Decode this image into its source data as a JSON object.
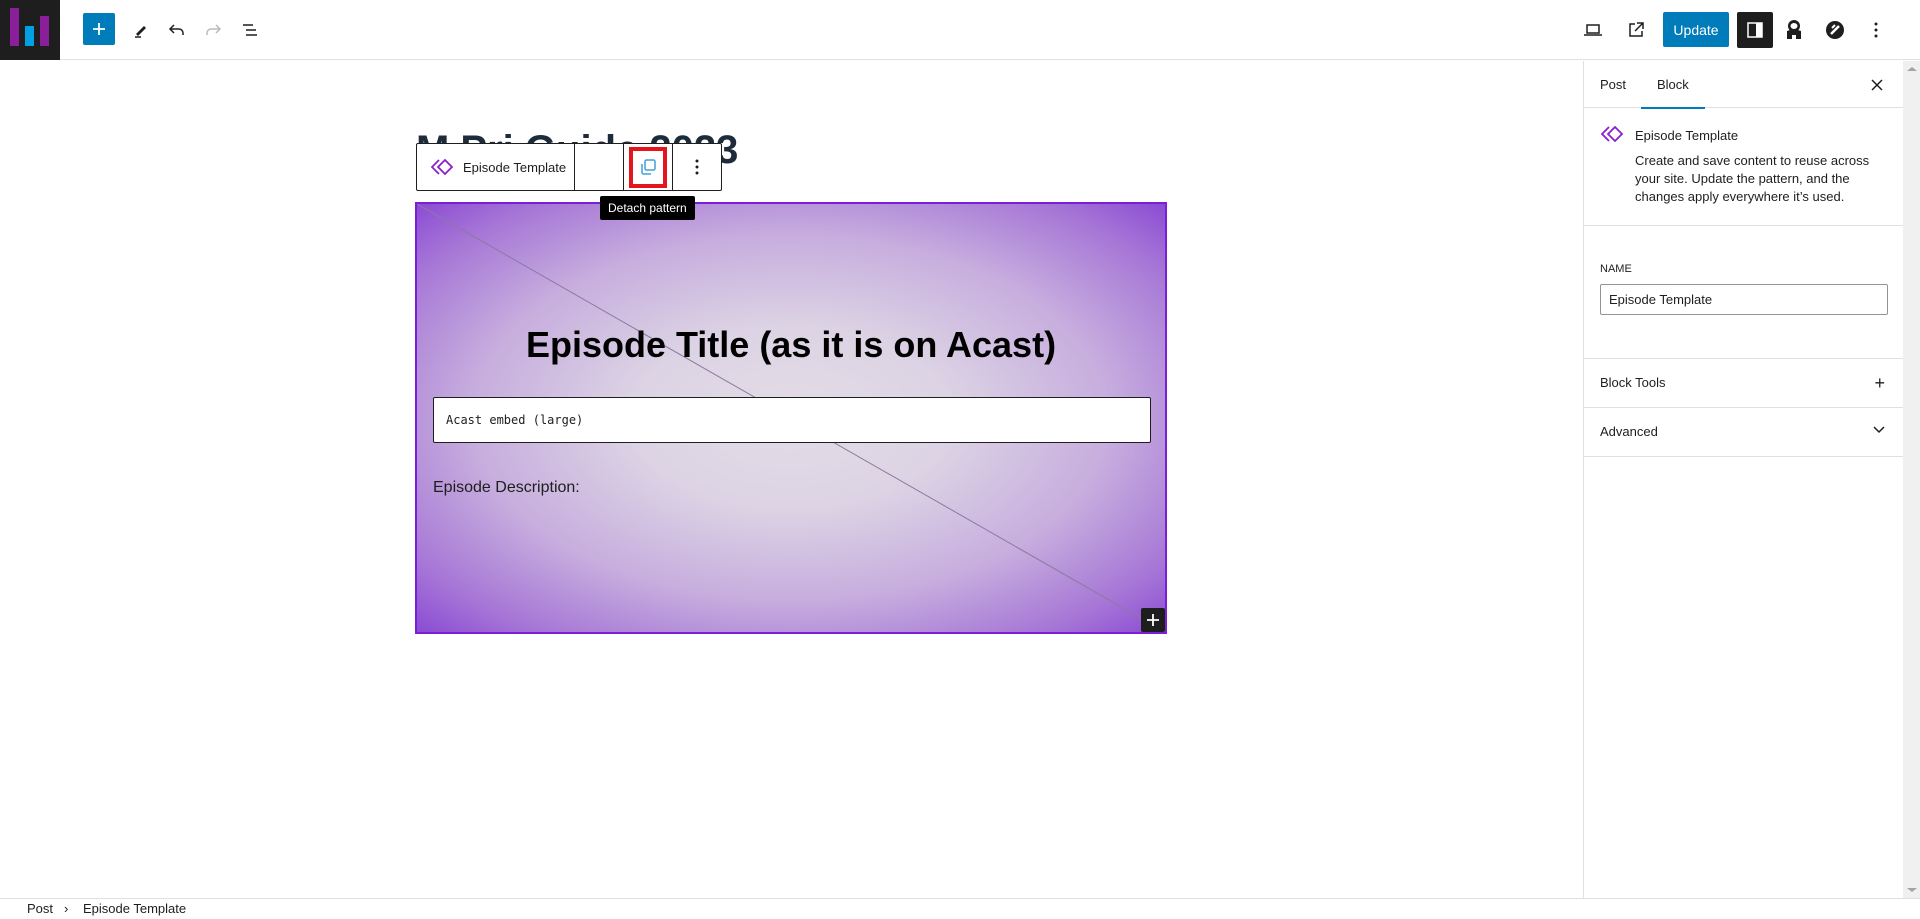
{
  "topbar": {
    "logo_icon": "site-logo-bars-icon",
    "logo_colors": [
      "#8b1e9b",
      "#00a0e3",
      "#8b1e9b"
    ],
    "inserter_icon": "plus-icon",
    "tools_icon": "pencil-icon",
    "undo_icon": "undo-icon",
    "redo_icon": "redo-icon",
    "list_view_icon": "list-view-icon",
    "preview_icon": "laptop-icon",
    "view_post_icon": "external-link-icon",
    "update_label": "Update",
    "settings_icon": "sidebar-toggle-icon",
    "plugin1_icon": "penguin-icon",
    "plugin2_icon": "circle-slash-icon",
    "options_icon": "more-vertical-icon",
    "accent_color": "#007cba"
  },
  "editor": {
    "post_title": "M         Pri   Guide 2023",
    "block_toolbar": {
      "parent_label": "Episode Template",
      "parent_icon": "synced-pattern-icon",
      "detach_icon": "detach-pattern-icon",
      "more_icon": "more-vertical-icon"
    },
    "tooltip": "Detach pattern",
    "cover": {
      "title": "Episode Title (as it is on Acast)",
      "embed_placeholder": "Acast embed (large)",
      "description_label": "Episode Description:",
      "appender_icon": "plus-icon",
      "border_color": "#7a1fd6"
    }
  },
  "sidebar": {
    "tabs": [
      {
        "label": "Post",
        "active": false
      },
      {
        "label": "Block",
        "active": true
      }
    ],
    "close_icon": "close-icon",
    "block_card": {
      "title": "Episode Template",
      "description": "Create and save content to reuse across your site. Update the pattern, and the changes apply everywhere it’s used."
    },
    "name_panel": {
      "label": "Name",
      "value": "Episode Template"
    },
    "panels": [
      {
        "label": "Block Tools",
        "icon": "plus-icon",
        "glyph": "+"
      },
      {
        "label": "Advanced",
        "icon": "chevron-down-icon",
        "glyph": "⌄"
      }
    ]
  },
  "footer": {
    "breadcrumbs": [
      "Post",
      "Episode Template"
    ],
    "separator": "›"
  }
}
